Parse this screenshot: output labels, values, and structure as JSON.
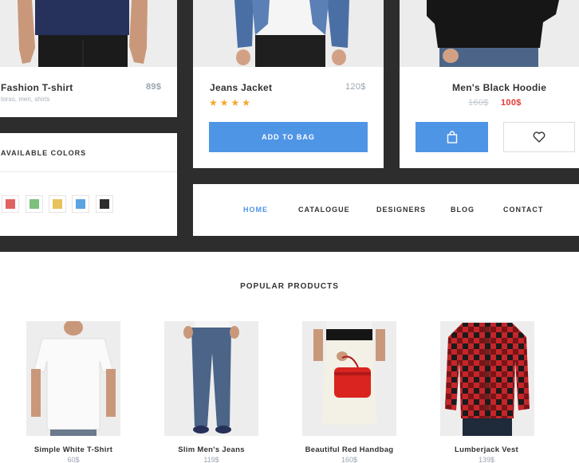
{
  "products_top": [
    {
      "name": "Fashion T-shirt",
      "price": "89$",
      "tags": "torso, men, shirts"
    },
    {
      "name": "Jeans Jacket",
      "price": "120$",
      "rating": "★★★★",
      "button": "ADD TO BAG"
    },
    {
      "name": "Men's Black Hoodie",
      "old_price": "160$",
      "new_price": "100$"
    }
  ],
  "colors": {
    "label": "AVAILABLE COLORS",
    "swatches": [
      "#e06363",
      "#7dc07d",
      "#e8c25a",
      "#5aa4e3",
      "#2c2c2c"
    ]
  },
  "nav": {
    "items": [
      "HOME",
      "CATALOGUE",
      "DESIGNERS",
      "BLOG",
      "CONTACT"
    ]
  },
  "popular": {
    "title": "POPULAR PRODUCTS",
    "items": [
      {
        "name": "Simple White T-Shirt",
        "price": "60$"
      },
      {
        "name": "Slim Men's Jeans",
        "price": "119$"
      },
      {
        "name": "Beautiful Red Handbag",
        "price": "160$"
      },
      {
        "name": "Lumberjack Vest",
        "price": "139$"
      }
    ]
  },
  "icons": {
    "bag": "shopping-bag-icon",
    "heart": "heart-icon"
  },
  "accent": "#4f95e6",
  "sale_color": "#e53935"
}
